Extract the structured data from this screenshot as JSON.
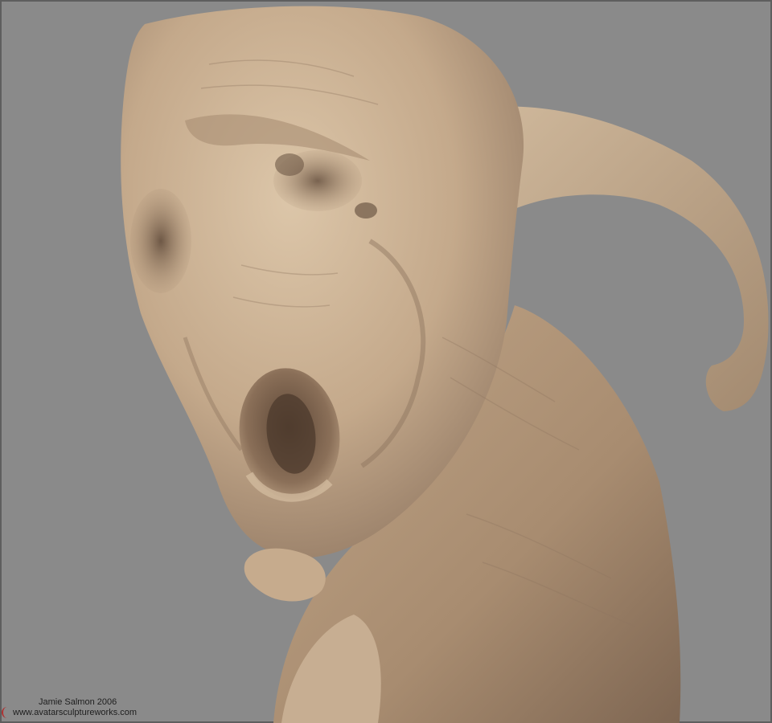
{
  "credit": {
    "author_line": "Jamie Salmon 2006",
    "website_line": "www.avatarsculptureworks.com"
  },
  "colors": {
    "background": "#8a8a8a",
    "skin_light": "#d7c0a3",
    "skin_mid": "#b89b7d",
    "skin_shadow": "#7a6450",
    "text": "#1e1e1e"
  }
}
